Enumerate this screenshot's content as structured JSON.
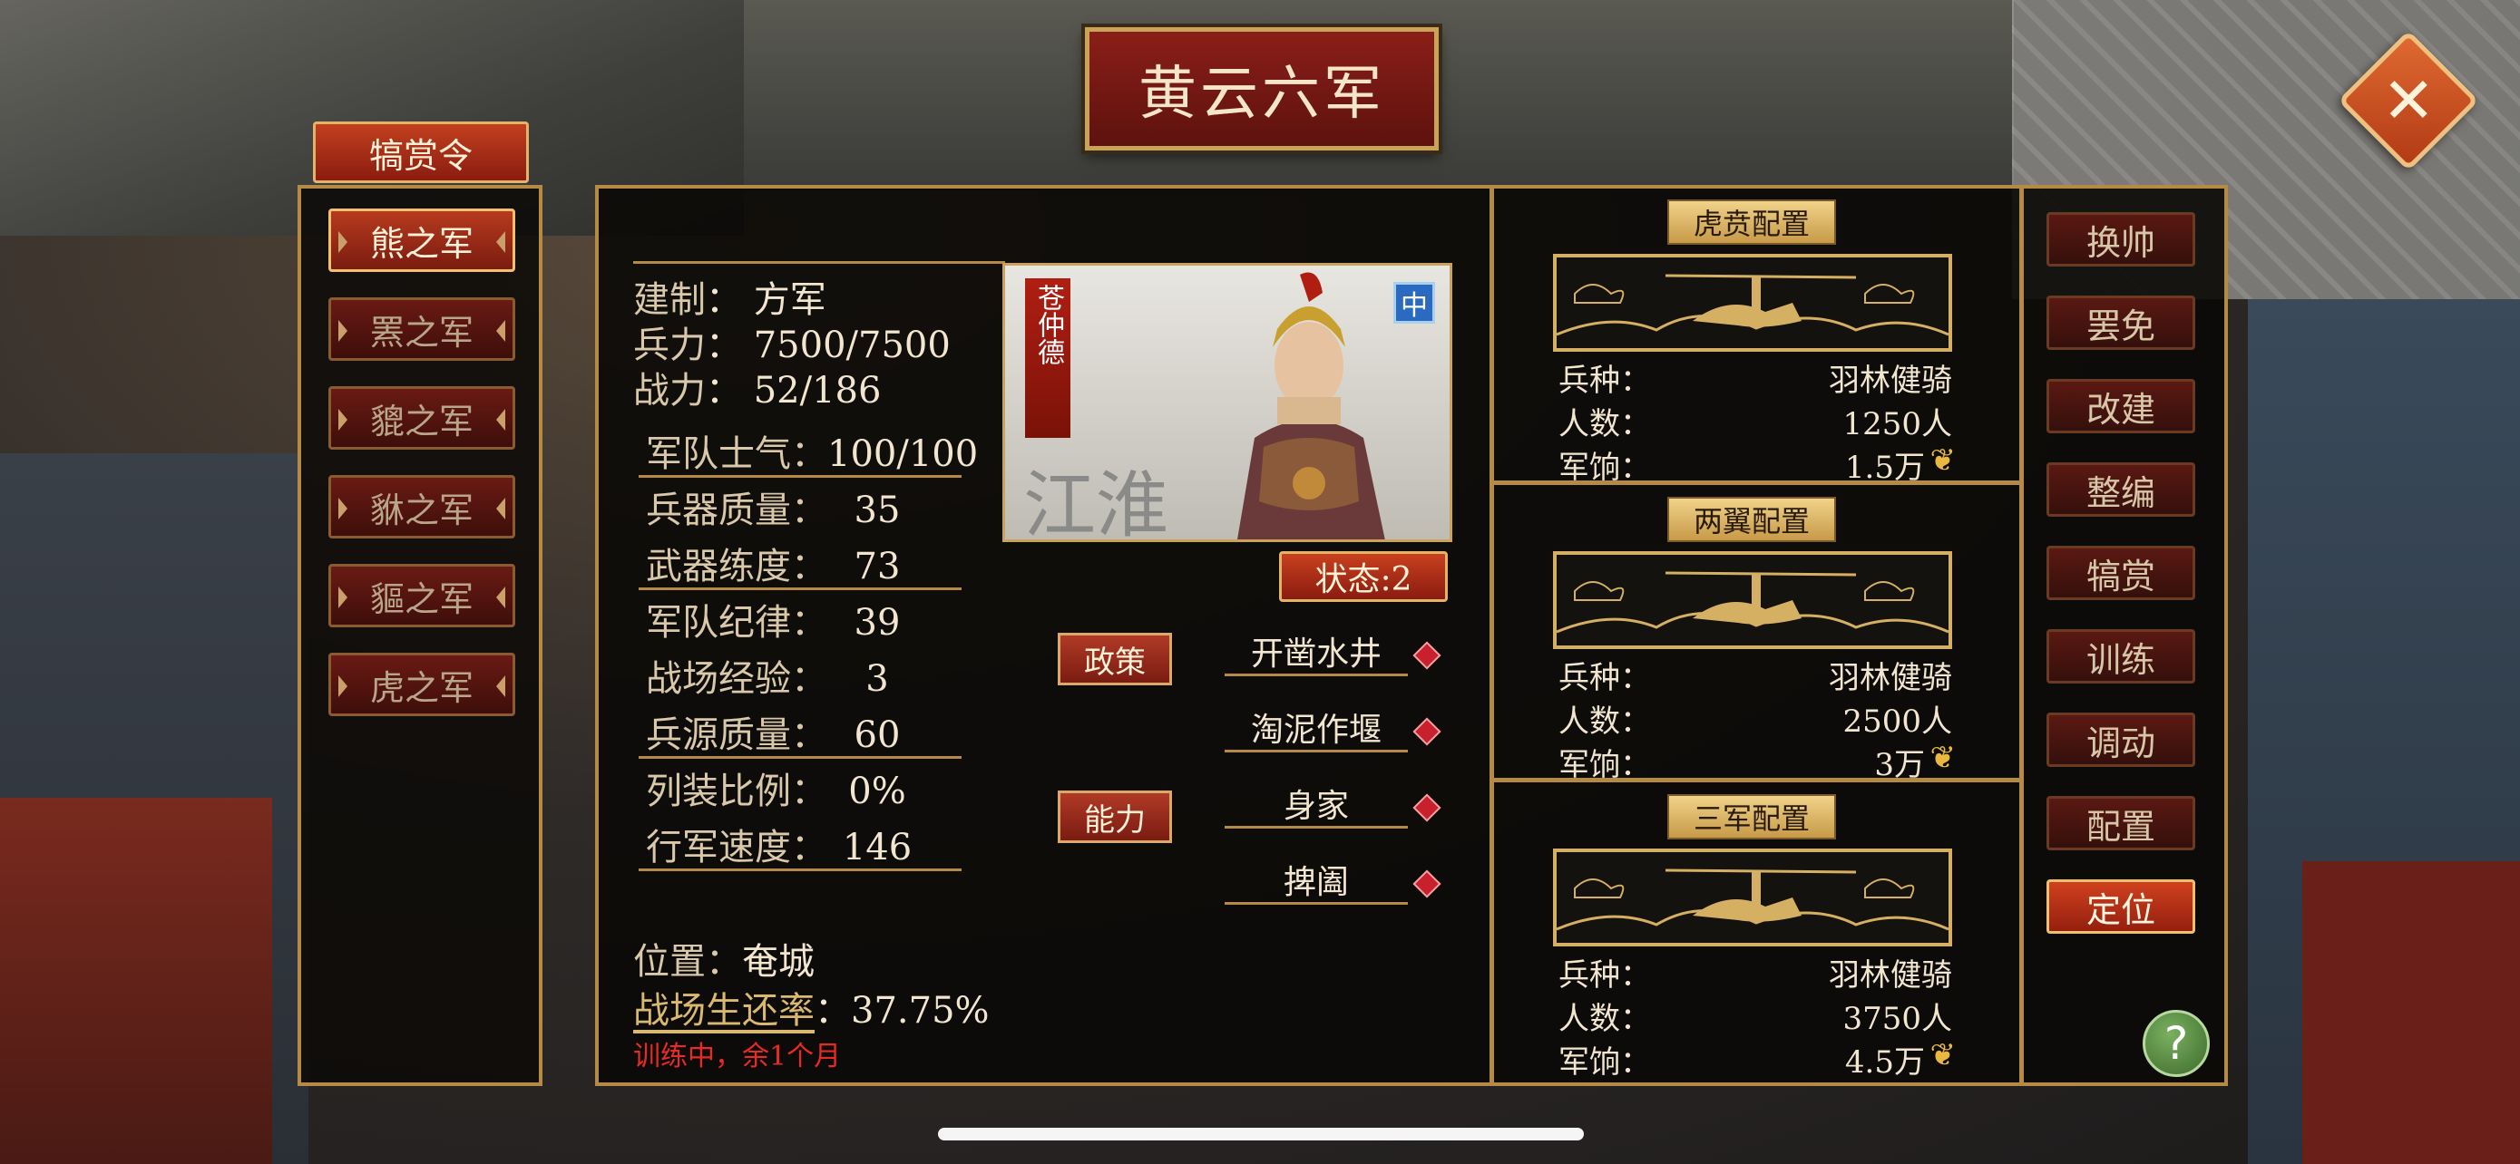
{
  "title": "黄云六军",
  "close_icon": "close-icon",
  "reward_tab": "犒赏令",
  "armies": [
    {
      "label": "熊之军",
      "active": true
    },
    {
      "label": "罴之军",
      "active": false
    },
    {
      "label": "貔之军",
      "active": false
    },
    {
      "label": "貅之军",
      "active": false
    },
    {
      "label": "貙之军",
      "active": false
    },
    {
      "label": "虎之军",
      "active": false
    }
  ],
  "stats_top": [
    {
      "label": "建制",
      "value": "方军"
    },
    {
      "label": "兵力",
      "value": "7500/7500"
    },
    {
      "label": "战力",
      "value": "52/186"
    }
  ],
  "stats": [
    {
      "label": "军队士气：",
      "value": "100/100"
    },
    {
      "label": "兵器质量：",
      "value": "35"
    },
    {
      "label": "武器练度：",
      "value": "73"
    },
    {
      "label": "军队纪律：",
      "value": "39"
    },
    {
      "label": "战场经验：",
      "value": "3"
    },
    {
      "label": "兵源质量：",
      "value": "60"
    },
    {
      "label": "列装比例：",
      "value": "0%"
    },
    {
      "label": "行军速度：",
      "value": "146"
    }
  ],
  "general": {
    "name": "苍仲德",
    "badge": "中",
    "background_text": "江淮"
  },
  "status_button": "状态:2",
  "policy_button": "政策",
  "ability_button": "能力",
  "policies": [
    "开凿水井",
    "淘泥作堰",
    "身家",
    "捭阖"
  ],
  "location": {
    "label": "位置：",
    "value": "奄城"
  },
  "survival": {
    "label": "战场生还率",
    "sep": "：",
    "value": "37.75%"
  },
  "training_note": "训练中，余1个月",
  "configs": [
    {
      "title": "虎贲配置",
      "troop_label": "兵种：",
      "troop": "羽林健骑",
      "count_label": "人数：",
      "count": "1250人",
      "pay_label": "军饷：",
      "pay": "1.5万"
    },
    {
      "title": "两翼配置",
      "troop_label": "兵种：",
      "troop": "羽林健骑",
      "count_label": "人数：",
      "count": "2500人",
      "pay_label": "军饷：",
      "pay": "3万"
    },
    {
      "title": "三军配置",
      "troop_label": "兵种：",
      "troop": "羽林健骑",
      "count_label": "人数：",
      "count": "3750人",
      "pay_label": "军饷：",
      "pay": "4.5万"
    }
  ],
  "commands": [
    {
      "label": "换帅",
      "primary": false
    },
    {
      "label": "罢免",
      "primary": false
    },
    {
      "label": "改建",
      "primary": false
    },
    {
      "label": "整编",
      "primary": false
    },
    {
      "label": "犒赏",
      "primary": false
    },
    {
      "label": "训练",
      "primary": false
    },
    {
      "label": "调动",
      "primary": false
    },
    {
      "label": "配置",
      "primary": false
    },
    {
      "label": "定位",
      "primary": true
    }
  ],
  "help_icon": "?",
  "colors": {
    "accent_gold": "#b58a44",
    "button_red": "#8a1c10",
    "warning_red": "#e82a24"
  }
}
